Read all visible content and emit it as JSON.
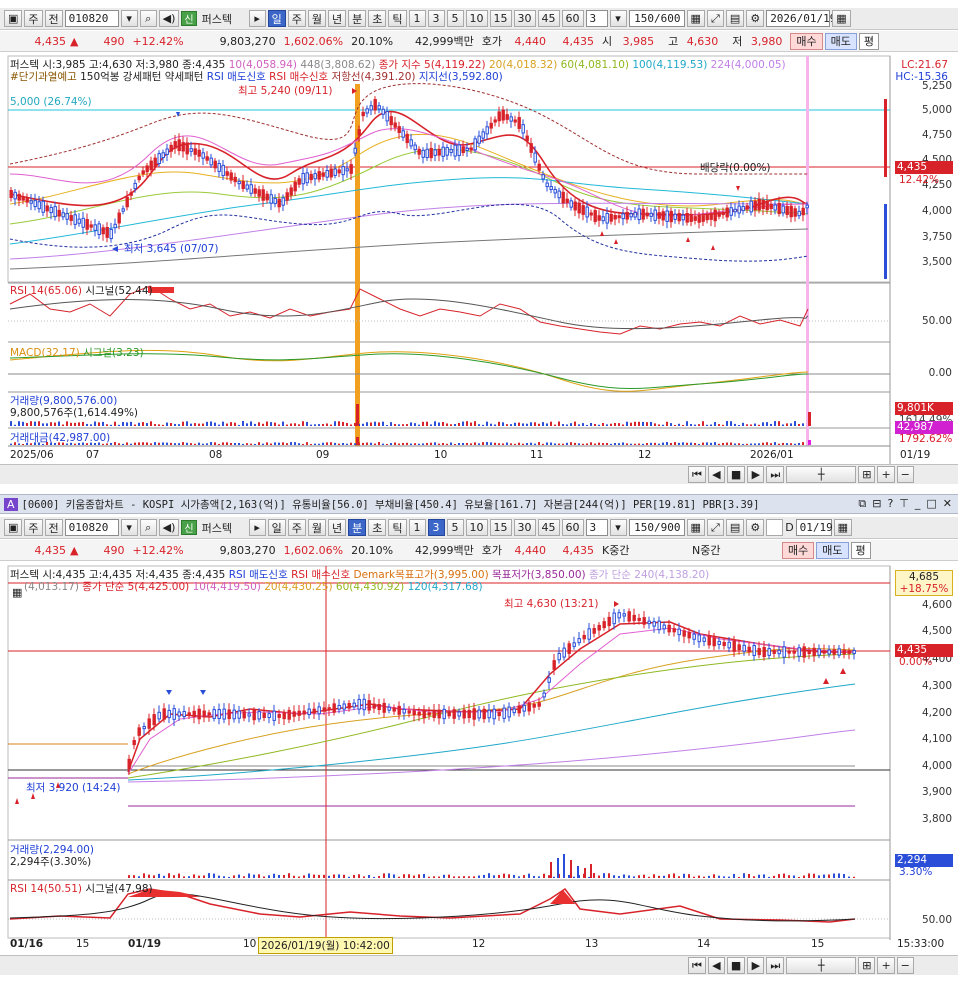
{
  "top": {
    "toolbar": {
      "market": "주",
      "prev": "전",
      "code": "010820",
      "sin": "신",
      "name": "퍼스텍",
      "periods": [
        "일",
        "주",
        "월",
        "년",
        "분",
        "초",
        "틱"
      ],
      "nums": [
        "1",
        "3",
        "5",
        "10",
        "15",
        "30",
        "45",
        "60"
      ],
      "num_val": "3",
      "count": "150/600",
      "date": "2026/01/19"
    },
    "quote": {
      "price": "4,435",
      "change": "490",
      "change_pct": "+12.42%",
      "volume": "9,803,270",
      "vol_pct": "1,602.06%",
      "rate": "20.10%",
      "amount": "42,999백만",
      "hoga_lbl": "호가",
      "hoga1": "4,440",
      "hoga2": "4,435",
      "open_lbl": "시",
      "open": "3,985",
      "high_lbl": "고",
      "high": "4,630",
      "low_lbl": "저",
      "low": "3,980",
      "buy": "매수",
      "sell": "매도",
      "avg": "평"
    },
    "legend1": "퍼스텍 시:3,985 고:4,630 저:3,980 종:4,435",
    "ma_legend": [
      "10(4,058.94)",
      "448(3,808.62)",
      "종가 지수 5(4,119.22)",
      "20(4,018.32)",
      "60(4,081.10)",
      "100(4,119.53)",
      "224(4,000.05)"
    ],
    "legend2": [
      "#단기과열예고",
      "150억봉 강세패턴",
      "약세패턴",
      "RSI 매도신호",
      "RSI 매수신호",
      "저항선(4,391.20)",
      "지지선(3,592.80)"
    ],
    "lc": "LC:21.67",
    "hc": "HC:-15.36",
    "line5000": "5,000 (26.74%)",
    "max_note": "최고 5,240 (09/11)",
    "min_note": "최저 3,645 (07/07)",
    "div_note": "배당락(0.00%)",
    "price_flag": "4,435",
    "pct_flag": "12.42%",
    "yticks": [
      "5,250",
      "5,000",
      "4,750",
      "4,500",
      "4,250",
      "4,000",
      "3,750",
      "3,500"
    ],
    "rsi_legend": "RSI 14(65.06)",
    "rsi_signal": "시그널(52.44)",
    "rsi_tick": "50.00",
    "macd_legend": "MACD(32,17)",
    "macd_signal": "시그널(3.23)",
    "macd_tick": "0.00",
    "vol_legend": "거래량(9,800,576.00)",
    "vol_text": "9,800,576주(1,614.49%)",
    "vol_flag": "9,801K",
    "vol_flag2": "1614.49%",
    "amt_legend": "거래대금(42,987.00)",
    "amt_flag": "42,987",
    "amt_flag2": "1792.62%",
    "xlabels": [
      "2025/06",
      "07",
      "08",
      "09",
      "10",
      "11",
      "12",
      "2026/01"
    ],
    "xright": "01/19"
  },
  "bottom": {
    "title": {
      "tag": "A",
      "text": "[0600] 키움종합차트 - KOSPI 시가총액[2,163(억)] 유통비율[56.0] 부채비율[450.4] 유보율[161.7] 자본금[244(억)] PER[19.81] PBR[3.39]"
    },
    "toolbar": {
      "market": "주",
      "prev": "전",
      "code": "010820",
      "sin": "신",
      "name": "퍼스텍",
      "periods": [
        "일",
        "주",
        "월",
        "년",
        "분",
        "초",
        "틱"
      ],
      "nums": [
        "1",
        "3",
        "5",
        "10",
        "15",
        "30",
        "45",
        "60"
      ],
      "num_val": "3",
      "count": "150/900",
      "d_lbl": "D",
      "date": "01/19"
    },
    "quote": {
      "price": "4,435",
      "change": "490",
      "change_pct": "+12.42%",
      "volume": "9,803,270",
      "vol_pct": "1,602.06%",
      "rate": "20.10%",
      "amount": "42,999백만",
      "hoga_lbl": "호가",
      "hoga1": "4,440",
      "hoga2": "4,435",
      "k_lbl": "K중간",
      "n_lbl": "N중간",
      "buy": "매수",
      "sell": "매도",
      "avg": "평"
    },
    "legend1": "퍼스텍 시:4,435 고:4,435 저:4,435 종:4,435",
    "legend1b": [
      "RSI 매도신호",
      "RSI 매수신호",
      "Demark목표고가(3,995.00)",
      "목표저가(3,850.00)",
      "종가 단순 240(4,138.20)"
    ],
    "legend2": [
      "(4,013.17)",
      "종가 단순 5(4,425.00)",
      "10(4,419.50)",
      "20(4,430.25)",
      "60(4,430.92)",
      "120(4,317.68)"
    ],
    "flag_top": "4,685",
    "flag_top_pct": "+18.75%",
    "max_note": "최고 4,630 (13:21)",
    "min_note": "최저 3,920 (14:24)",
    "price_flag": "4,435",
    "pct_label": "0.00%",
    "yticks": [
      "4,600",
      "4,500",
      "4,400",
      "4,300",
      "4,200",
      "4,100",
      "4,000",
      "3,900",
      "3,800"
    ],
    "vol_legend": "거래량(2,294.00)",
    "vol_text": "2,294주(3.30%)",
    "vol_flag": "2,294",
    "vol_flag2": "3.30%",
    "rsi_legend": "RSI 14(50.51)",
    "rsi_signal": "시그널(47.98)",
    "rsi_tick": "50.00",
    "xlabels": [
      "01/16",
      "15",
      "01/19",
      "10",
      "12",
      "13",
      "14",
      "15"
    ],
    "cursor_time": "2026/01/19(월) 10:42:00",
    "xright": "15:33:00"
  }
}
